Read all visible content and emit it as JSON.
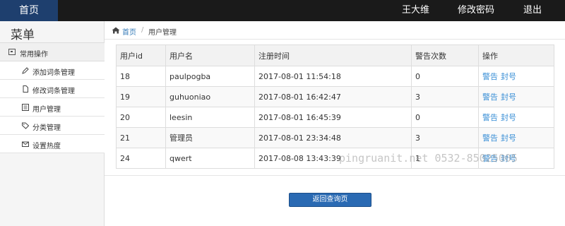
{
  "header": {
    "brand": "首页",
    "user": "王大维",
    "change_password": "修改密码",
    "logout": "退出"
  },
  "sidebar": {
    "title": "菜单",
    "group_label": "常用操作",
    "items": [
      {
        "label": "添加词条管理",
        "icon": "pencil-icon"
      },
      {
        "label": "修改词条管理",
        "icon": "file-icon"
      },
      {
        "label": "用户管理",
        "icon": "list-icon"
      },
      {
        "label": "分类管理",
        "icon": "tag-icon"
      },
      {
        "label": "设置热度",
        "icon": "envelope-icon"
      }
    ]
  },
  "breadcrumb": {
    "home": "首页",
    "separator": "/",
    "current": "用户管理"
  },
  "table": {
    "headers": [
      "用户id",
      "用户名",
      "注册时间",
      "警告次数",
      "操作"
    ],
    "rows": [
      {
        "id": "18",
        "name": "paulpogba",
        "time": "2017-08-01 11:54:18",
        "warnings": "0",
        "warn_action": "警告",
        "ban_action": "封号"
      },
      {
        "id": "19",
        "name": "guhuoniao",
        "time": "2017-08-01 16:42:47",
        "warnings": "3",
        "warn_action": "警告",
        "ban_action": "封号"
      },
      {
        "id": "20",
        "name": "leesin",
        "time": "2017-08-01 16:45:39",
        "warnings": "0",
        "warn_action": "警告",
        "ban_action": "封号"
      },
      {
        "id": "21",
        "name": "管理员",
        "time": "2017-08-01 23:34:48",
        "warnings": "3",
        "warn_action": "警告",
        "ban_action": "封号"
      },
      {
        "id": "24",
        "name": "qwert",
        "time": "2017-08-08 13:43:39",
        "warnings": "1",
        "warn_action": "警告",
        "ban_action": "封号"
      }
    ]
  },
  "back_button": "返回查询页",
  "watermark": "pingruanit.net 0532-85025005",
  "colors": {
    "topbar": "#1a1a1a",
    "brand": "#1e3f6e",
    "link": "#3a8fd6",
    "button": "#2a6ab3"
  }
}
